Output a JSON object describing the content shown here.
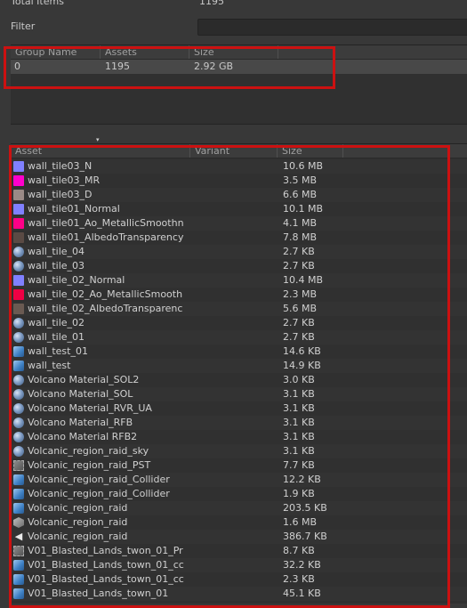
{
  "summary": {
    "label": "Total Items",
    "value": "1195"
  },
  "filter": {
    "label": "Filter",
    "value": ""
  },
  "groups_table": {
    "headers": [
      "Group Name",
      "Assets",
      "Size"
    ],
    "rows": [
      {
        "name": "0",
        "assets": "1195",
        "size": "2.92 GB"
      }
    ]
  },
  "assets_table": {
    "headers": [
      "Asset",
      "Variant",
      "Size"
    ],
    "sort_indicator": "▾",
    "rows": [
      {
        "icon": "normal-map-icon",
        "color": "#8080ff",
        "name": "wall_tile03_N",
        "size": "10.6 MB"
      },
      {
        "icon": "mask-map-icon",
        "color": "#ff00cc",
        "name": "wall_tile03_MR",
        "size": "3.5 MB"
      },
      {
        "icon": "diffuse-texture-icon",
        "color": "#9a8a86",
        "name": "wall_tile03_D",
        "size": "6.6 MB"
      },
      {
        "icon": "normal-map-icon",
        "color": "#8080ff",
        "name": "wall_tile01_Normal",
        "size": "10.1 MB"
      },
      {
        "icon": "mask-map-icon",
        "color": "#ff0088",
        "name": "wall_tile01_Ao_MetallicSmoothn",
        "size": "4.1 MB"
      },
      {
        "icon": "albedo-texture-icon",
        "color": "#5a4a44",
        "name": "wall_tile01_AlbedoTransparency",
        "size": "7.8 MB"
      },
      {
        "icon": "material-icon",
        "name": "wall_tile_04",
        "size": "2.7 KB"
      },
      {
        "icon": "material-icon",
        "name": "wall_tile_03",
        "size": "2.7 KB"
      },
      {
        "icon": "normal-map-icon",
        "color": "#8080ff",
        "name": "wall_tile_02_Normal",
        "size": "10.4 MB"
      },
      {
        "icon": "mask-map-icon",
        "color": "#ee0044",
        "name": "wall_tile_02_Ao_MetallicSmooth",
        "size": "2.3 MB"
      },
      {
        "icon": "albedo-texture-icon",
        "color": "#6a5a52",
        "name": "wall_tile_02_AlbedoTransparenc",
        "size": "5.6 MB"
      },
      {
        "icon": "material-icon",
        "name": "wall_tile_02",
        "size": "2.7 KB"
      },
      {
        "icon": "material-icon",
        "name": "wall_tile_01",
        "size": "2.7 KB"
      },
      {
        "icon": "prefab-icon",
        "name": "wall_test_01",
        "size": "14.6 KB"
      },
      {
        "icon": "prefab-icon",
        "name": "wall_test",
        "size": "14.9 KB"
      },
      {
        "icon": "material-icon",
        "name": "Volcano Material_SOL2",
        "size": "3.0 KB"
      },
      {
        "icon": "material-icon",
        "name": "Volcano Material_SOL",
        "size": "3.1 KB"
      },
      {
        "icon": "material-icon",
        "name": "Volcano Material_RVR_UA",
        "size": "3.1 KB"
      },
      {
        "icon": "material-icon",
        "name": "Volcano Material_RFB",
        "size": "3.1 KB"
      },
      {
        "icon": "material-icon",
        "name": "Volcano Material RFB2",
        "size": "3.1 KB"
      },
      {
        "icon": "material-icon",
        "name": "Volcanic_region_raid_sky",
        "size": "3.1 KB"
      },
      {
        "icon": "collider-icon",
        "name": "Volcanic_region_raid_PST",
        "size": "7.7 KB"
      },
      {
        "icon": "prefab-icon",
        "name": "Volcanic_region_raid_Collider",
        "size": "12.2 KB"
      },
      {
        "icon": "prefab-icon",
        "name": "Volcanic_region_raid_Collider",
        "size": "1.9 KB"
      },
      {
        "icon": "prefab-icon",
        "name": "Volcanic_region_raid",
        "size": "203.5 KB"
      },
      {
        "icon": "mesh-icon",
        "name": "Volcanic_region_raid",
        "size": "1.6 MB"
      },
      {
        "icon": "audio-icon",
        "name": "Volcanic_region_raid",
        "size": "386.7 KB"
      },
      {
        "icon": "collider-icon",
        "name": "V01_Blasted_Lands_twon_01_Pr",
        "size": "8.7 KB"
      },
      {
        "icon": "prefab-icon",
        "name": "V01_Blasted_Lands_town_01_cc",
        "size": "32.2 KB"
      },
      {
        "icon": "prefab-icon",
        "name": "V01_Blasted_Lands_town_01_cc",
        "size": "2.3 KB"
      },
      {
        "icon": "prefab-icon",
        "name": "V01_Blasted_Lands_town_01",
        "size": "45.1 KB"
      }
    ]
  },
  "highlight_color": "#cc1111"
}
